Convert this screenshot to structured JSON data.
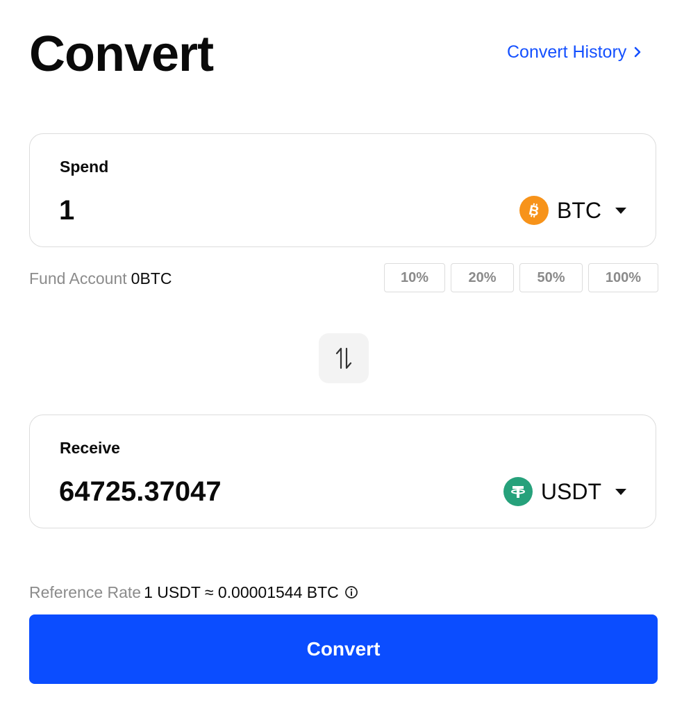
{
  "header": {
    "title": "Convert",
    "history_link": "Convert History"
  },
  "spend": {
    "label": "Spend",
    "amount": "1",
    "coin": "BTC",
    "coin_icon": "bitcoin-icon",
    "coin_color": "#f7931a"
  },
  "fund": {
    "label": "Fund Account",
    "value": "0BTC"
  },
  "percent_buttons": [
    "10%",
    "20%",
    "50%",
    "100%"
  ],
  "receive": {
    "label": "Receive",
    "amount": "64725.37047",
    "coin": "USDT",
    "coin_icon": "tether-icon",
    "coin_color": "#26a17b"
  },
  "reference": {
    "label": "Reference Rate",
    "value": "1 USDT ≈ 0.00001544 BTC"
  },
  "action": {
    "convert_label": "Convert"
  },
  "colors": {
    "accent": "#0b4dff",
    "link": "#1450ff"
  }
}
